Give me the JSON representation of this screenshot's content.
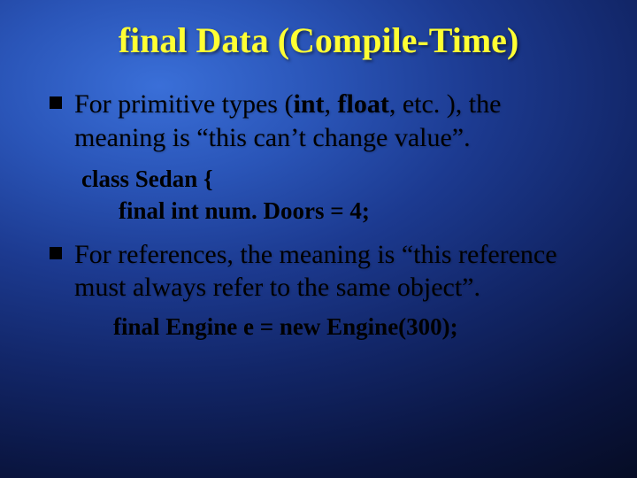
{
  "title": "final Data (Compile-Time)",
  "bullets": [
    {
      "pre": "For primitive types (",
      "kw1": "int",
      "mid1": ", ",
      "kw2": "float",
      "post": ", etc. ), the meaning is “this can’t change value”."
    },
    {
      "text": "For references, the meaning is “this reference must always refer to the same object”."
    }
  ],
  "code1": {
    "line1": "class Sedan {",
    "line2": "final int num. Doors = 4;"
  },
  "code2": "final Engine e = new Engine(300);"
}
